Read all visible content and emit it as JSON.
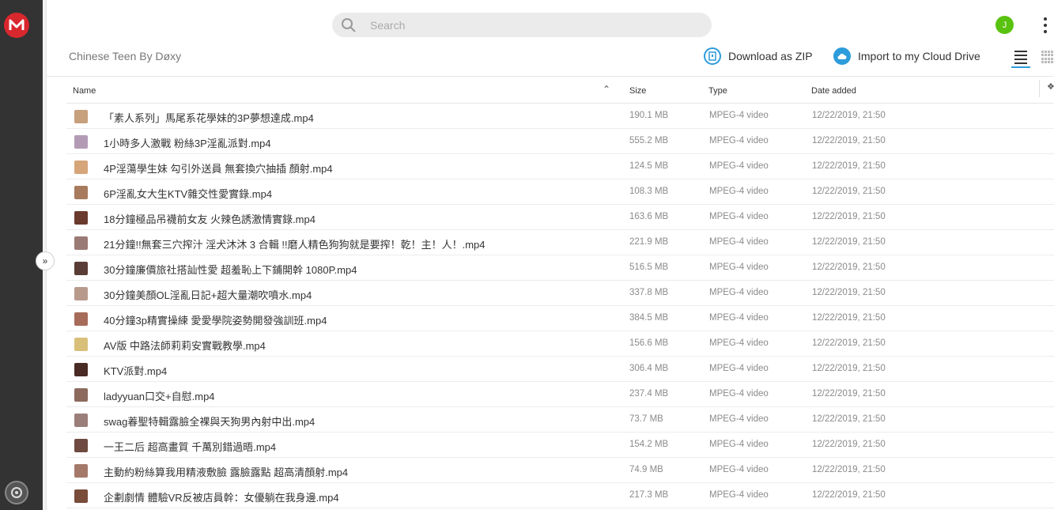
{
  "search": {
    "placeholder": "Search"
  },
  "user": {
    "avatar_letter": "J"
  },
  "folder": {
    "title": "Chinese Teen By Døxy"
  },
  "actions": {
    "download_zip": "Download as ZIP",
    "import_cloud": "Import to my Cloud Drive"
  },
  "columns": {
    "name": "Name",
    "size": "Size",
    "type": "Type",
    "date": "Date added"
  },
  "colors": {
    "accent": "#2d9cdb",
    "brand": "#d9272e",
    "avatar": "#59c20e"
  },
  "files": [
    {
      "name": "「素人系列」馬尾系花學妹的3P夢想達成.mp4",
      "size": "190.1 MB",
      "type": "MPEG-4 video",
      "date": "12/22/2019, 21:50",
      "thumb": "#c7a07d"
    },
    {
      "name": "1小時多人激戰 粉絲3P淫亂派對.mp4",
      "size": "555.2 MB",
      "type": "MPEG-4 video",
      "date": "12/22/2019, 21:50",
      "thumb": "#b39bb5"
    },
    {
      "name": "4P淫蕩學生妹 勾引外送員 無套換穴抽插 顏射.mp4",
      "size": "124.5 MB",
      "type": "MPEG-4 video",
      "date": "12/22/2019, 21:50",
      "thumb": "#d6a57a"
    },
    {
      "name": "6P淫亂女大生KTV雜交性愛實錄.mp4",
      "size": "108.3 MB",
      "type": "MPEG-4 video",
      "date": "12/22/2019, 21:50",
      "thumb": "#a87a5e"
    },
    {
      "name": "18分鐘極品吊襪前女友 火辣色誘激情實錄.mp4",
      "size": "163.6 MB",
      "type": "MPEG-4 video",
      "date": "12/22/2019, 21:50",
      "thumb": "#6b3a2e"
    },
    {
      "name": "21分鐘!!無套三穴搾汁 淫犬沐沐 3 合輯 !!磨人精色狗狗就是要搾！乾！主！人！.mp4",
      "size": "221.9 MB",
      "type": "MPEG-4 video",
      "date": "12/22/2019, 21:50",
      "thumb": "#9a7a74"
    },
    {
      "name": "30分鐘廉價旅社搭訕性愛 超羞恥上下鋪開幹 1080P.mp4",
      "size": "516.5 MB",
      "type": "MPEG-4 video",
      "date": "12/22/2019, 21:50",
      "thumb": "#5a3d36"
    },
    {
      "name": "30分鐘美顏OL淫亂日記+超大量潮吹噴水.mp4",
      "size": "337.8 MB",
      "type": "MPEG-4 video",
      "date": "12/22/2019, 21:50",
      "thumb": "#b89a8c"
    },
    {
      "name": "40分鐘3p精實操練 愛愛學院姿勢開發強訓班.mp4",
      "size": "384.5 MB",
      "type": "MPEG-4 video",
      "date": "12/22/2019, 21:50",
      "thumb": "#a76b5a"
    },
    {
      "name": "AV版 中路法師莉莉安實戰教學.mp4",
      "size": "156.6 MB",
      "type": "MPEG-4 video",
      "date": "12/22/2019, 21:50",
      "thumb": "#d9c07a"
    },
    {
      "name": "KTV派對.mp4",
      "size": "306.4 MB",
      "type": "MPEG-4 video",
      "date": "12/22/2019, 21:50",
      "thumb": "#4a2a24"
    },
    {
      "name": "ladyyuan口交+自慰.mp4",
      "size": "237.4 MB",
      "type": "MPEG-4 video",
      "date": "12/22/2019, 21:50",
      "thumb": "#8c6a5e"
    },
    {
      "name": "swag萶聖特輯露臉全裸與天狗男內射中出.mp4",
      "size": "73.7 MB",
      "type": "MPEG-4 video",
      "date": "12/22/2019, 21:50",
      "thumb": "#9a7e7a"
    },
    {
      "name": "一王二后 超高畫質 千萬別錯過晤.mp4",
      "size": "154.2 MB",
      "type": "MPEG-4 video",
      "date": "12/22/2019, 21:50",
      "thumb": "#6e4a40"
    },
    {
      "name": "主動約粉絲算我用精液敷臉 露臉露點 超高清顏射.mp4",
      "size": "74.9 MB",
      "type": "MPEG-4 video",
      "date": "12/22/2019, 21:50",
      "thumb": "#a5796a"
    },
    {
      "name": "企劃劇情 體驗VR反被店員幹：女優躺在我身邊.mp4",
      "size": "217.3 MB",
      "type": "MPEG-4 video",
      "date": "12/22/2019, 21:50",
      "thumb": "#7a4c3a"
    }
  ]
}
